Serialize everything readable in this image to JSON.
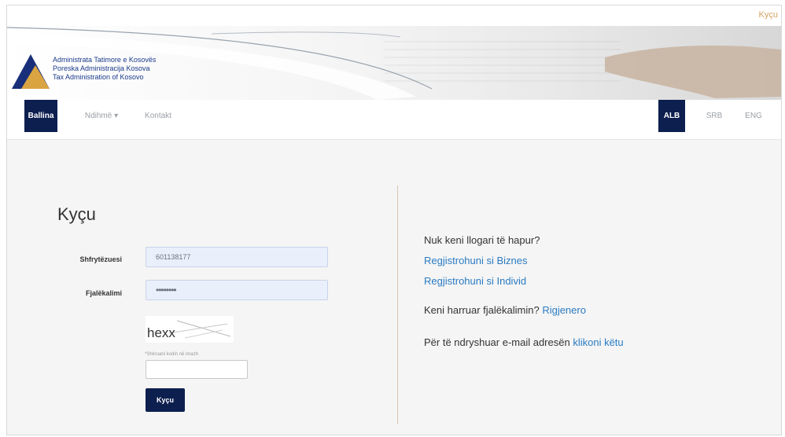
{
  "top_bar": {
    "login_link": "Kyçu"
  },
  "logo": {
    "lines": [
      "Administrata Tatimore e Kosovës",
      "Poreska Administracija Kosova",
      "Tax Administration of Kosovo"
    ],
    "colors": {
      "navy": "#1a2f7a",
      "gold": "#d9a441"
    }
  },
  "nav": {
    "items": [
      {
        "label": "Ballina",
        "active": true
      },
      {
        "label": "Ndihmë ▾",
        "active": false
      },
      {
        "label": "Kontakt",
        "active": false
      }
    ],
    "languages": [
      {
        "label": "ALB",
        "active": true
      },
      {
        "label": "SRB",
        "active": false
      },
      {
        "label": "ENG",
        "active": false
      }
    ]
  },
  "login": {
    "title": "Kyçu",
    "username_label": "Shfrytëzuesi",
    "username_value": "601138177",
    "password_label": "Fjalëkalimi",
    "password_value": "••••••••",
    "captcha_text": "hexx",
    "captcha_hint": "*Shkruani kodin në imazh",
    "captcha_input_value": "",
    "submit_label": "Kyçu"
  },
  "side": {
    "no_account_text": "Nuk keni llogari të hapur?",
    "register_business": "Regjistrohuni si Biznes",
    "register_individual": "Regjistrohuni si Individ",
    "forgot_text": "Keni harruar fjalëkalimin?",
    "regenerate_link": "Rigjenero",
    "change_email_text": "Për të ndryshuar e-mail adresën",
    "click_here_link": "klikoni këtu"
  },
  "colors": {
    "primary": "#0d1f4f",
    "link": "#2a7bc2",
    "divider": "#d8c7b4"
  }
}
